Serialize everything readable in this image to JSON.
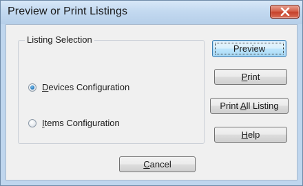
{
  "window": {
    "title": "Preview or Print Listings"
  },
  "group": {
    "legend": "Listing Selection",
    "options": [
      {
        "prefix": "",
        "mnemonic": "D",
        "rest": "evices Configuration",
        "selected": true
      },
      {
        "prefix": "",
        "mnemonic": "I",
        "rest": "tems Configuration",
        "selected": false
      }
    ]
  },
  "buttons": {
    "preview": {
      "prefix": "Preview",
      "mnemonic": "",
      "rest": ""
    },
    "print": {
      "prefix": "",
      "mnemonic": "P",
      "rest": "rint"
    },
    "print_all": {
      "prefix": "Print ",
      "mnemonic": "A",
      "rest": "ll Listing"
    },
    "help": {
      "prefix": "",
      "mnemonic": "H",
      "rest": "elp"
    },
    "cancel": {
      "prefix": "",
      "mnemonic": "C",
      "rest": "ancel"
    }
  },
  "icons": {
    "close": "close-icon"
  },
  "colors": {
    "title_bar": "#c3d9f0",
    "client_background": "#f0f0f0",
    "close_button": "#c7402a",
    "default_button_border": "#3c7fb1",
    "radio_dot": "#2a7cc0"
  }
}
